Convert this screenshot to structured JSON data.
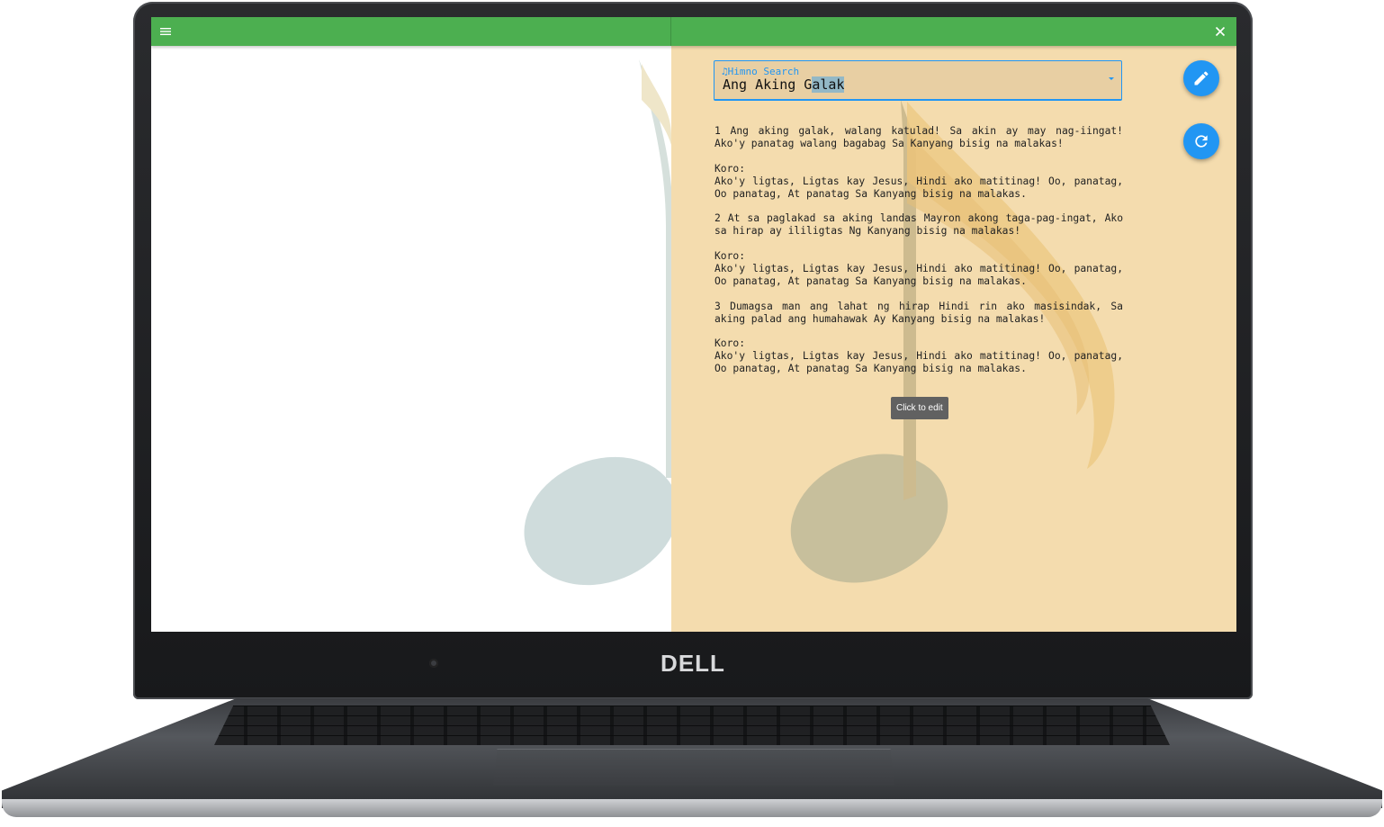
{
  "device": {
    "brand": "DELL"
  },
  "app": {
    "topbar": {
      "menu_icon": "menu-icon",
      "close_icon": "close-icon"
    },
    "search": {
      "label": "Himno Search",
      "label_icon": "music-note-icon",
      "value_before_selection": "Ang Aking G",
      "value_selected": "alak"
    },
    "lyrics": [
      "1 Ang aking galak, walang katulad! Sa akin ay may nag-iingat! Ako'y panatag walang bagabag Sa Kanyang bisig na malakas!",
      "Koro:\nAko'y ligtas, Ligtas kay Jesus, Hindi ako matitinag! Oo, panatag, Oo panatag, At panatag Sa Kanyang bisig na malakas.",
      "2 At sa paglakad sa aking landas Mayron akong taga-pag-ingat, Ako sa hirap ay ililigtas Ng Kanyang bisig na malakas!",
      "Koro:\nAko'y ligtas, Ligtas kay Jesus, Hindi ako matitinag! Oo, panatag, Oo panatag, At panatag Sa Kanyang bisig na malakas.",
      "3 Dumagsa man ang lahat ng hirap Hindi rin ako masisindak, Sa aking palad ang humahawak Ay Kanyang bisig na malakas!",
      "Koro:\nAko'y ligtas, Ligtas kay Jesus, Hindi ako matitinag! Oo, panatag, Oo panatag, At panatag Sa Kanyang bisig na malakas."
    ],
    "tooltip": "Click to edit",
    "fabs": {
      "edit_icon": "pencil-icon",
      "refresh_icon": "refresh-icon"
    },
    "colors": {
      "topbar": "#4caf50",
      "lyrics_pane": "#f4dcae",
      "accent": "#2196f3"
    }
  }
}
